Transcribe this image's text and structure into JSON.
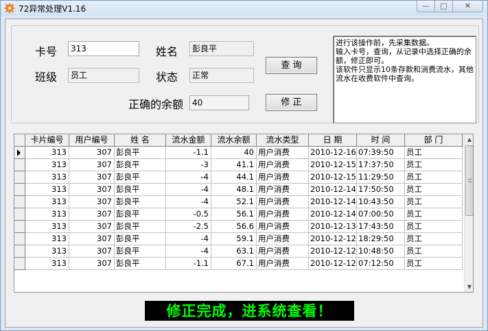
{
  "window": {
    "title": "72异常处理V1.16",
    "min_symbol": "—",
    "max_symbol": "□",
    "close_symbol": "✕"
  },
  "form": {
    "card_label": "卡号",
    "card_value": "313",
    "name_label": "姓名",
    "name_value": "彭良平",
    "class_label": "班级",
    "class_value": "员工",
    "state_label": "状态",
    "state_value": "正常",
    "balance_label": "正确的余额",
    "balance_value": "40",
    "query_button": "查 询",
    "fix_button": "修 正"
  },
  "info_text": "进行该操作前，先采集数据。\n输入卡号，查询，从记录中选择正确的余额，修正即可。\n该软件只显示10条存款和消费流水，其他流水在收费软件中查询。",
  "table": {
    "columns": [
      "卡片编号",
      "用户编号",
      "姓  名",
      "流水金额",
      "流水余额",
      "流水类型",
      "日  期",
      "时  间",
      "部  门"
    ],
    "rows": [
      [
        "313",
        "307",
        "彭良平",
        "-1.1",
        "40",
        "用户消费",
        "2010-12-16",
        "07:39:50",
        "员工"
      ],
      [
        "313",
        "307",
        "彭良平",
        "-3",
        "41.1",
        "用户消费",
        "2010-12-15",
        "17:37:50",
        "员工"
      ],
      [
        "313",
        "307",
        "彭良平",
        "-4",
        "44.1",
        "用户消费",
        "2010-12-15",
        "11:29:50",
        "员工"
      ],
      [
        "313",
        "307",
        "彭良平",
        "-4",
        "48.1",
        "用户消费",
        "2010-12-14",
        "17:50:50",
        "员工"
      ],
      [
        "313",
        "307",
        "彭良平",
        "-4",
        "52.1",
        "用户消费",
        "2010-12-14",
        "10:43:50",
        "员工"
      ],
      [
        "313",
        "307",
        "彭良平",
        "-0.5",
        "56.1",
        "用户消费",
        "2010-12-14",
        "07:00:50",
        "员工"
      ],
      [
        "313",
        "307",
        "彭良平",
        "-2.5",
        "56.6",
        "用户消费",
        "2010-12-13",
        "17:43:50",
        "员工"
      ],
      [
        "313",
        "307",
        "彭良平",
        "-4",
        "59.1",
        "用户消费",
        "2010-12-12",
        "18:29:50",
        "员工"
      ],
      [
        "313",
        "307",
        "彭良平",
        "-4",
        "63.1",
        "用户消费",
        "2010-12-12",
        "10:48:50",
        "员工"
      ],
      [
        "313",
        "307",
        "彭良平",
        "-1.1",
        "67.1",
        "用户消费",
        "2010-12-12",
        "07:12:50",
        "员工"
      ]
    ]
  },
  "status_message": "修正完成，进系统查看！",
  "colors": {
    "status_bg": "#000000",
    "status_text": "#00ff00",
    "app_icon": "#f07d1b"
  },
  "icons": {
    "app": "gear-icon",
    "row_pointer": "row-pointer-icon",
    "scroll_up": "scroll-up-icon",
    "scroll_down": "scroll-down-icon"
  }
}
